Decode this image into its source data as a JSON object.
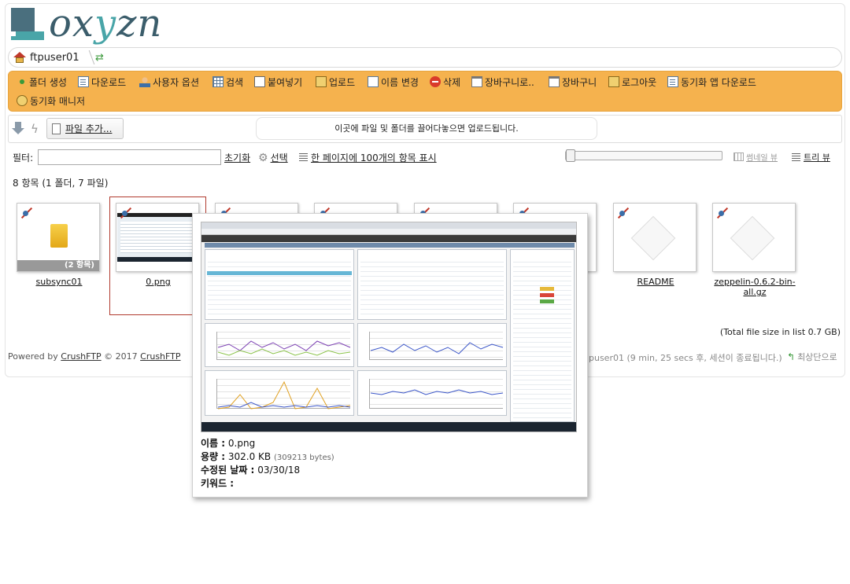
{
  "brand": {
    "logo_text_a": "ox",
    "logo_text_b": "y",
    "logo_text_c": "zn"
  },
  "breadcrumb": {
    "user": "ftpuser01"
  },
  "toolbar": {
    "items": [
      {
        "label": "폴더 생성"
      },
      {
        "label": "다운로드"
      },
      {
        "label": "사용자 옵션"
      },
      {
        "label": "검색"
      },
      {
        "label": "붙여넣기"
      },
      {
        "label": "업로드"
      },
      {
        "label": "이름 변경"
      },
      {
        "label": "삭제"
      },
      {
        "label": "장바구니로.."
      },
      {
        "label": "장바구니"
      },
      {
        "label": "로그아웃"
      },
      {
        "label": "동기화 앱 다운로드"
      },
      {
        "label": "동기화 매니저"
      }
    ]
  },
  "upload": {
    "add_file_label": "파일 추가...",
    "drop_text": "이곳에 파일 및 폴더를 끌어다놓으면 업로드됩니다."
  },
  "filter": {
    "label": "필터:",
    "value": "",
    "reset_label": "초기화",
    "select_label": "선택",
    "per_page_label": "한 페이지에 100개의 항목 표시",
    "thumbnail_view_label": "썸네일 뷰",
    "tree_view_label": "트리 뷰"
  },
  "listing": {
    "count_text": "8 항목 (1 폴더, 7 파일)",
    "items": [
      {
        "name": "subsync01",
        "caption": "(2 항목)"
      },
      {
        "name": "0.png"
      },
      {
        "name": "README"
      },
      {
        "name": "zeppelin-0.6.2-bin-all.gz"
      }
    ],
    "total_size_text": "(Total file size in list 0.7 GB)"
  },
  "footer": {
    "powered_by": "Powered by",
    "crushftp": "CrushFTP",
    "copyright": "© 2017",
    "crushftp2": "CrushFTP",
    "session_text": "puser01 (9 min, 25 secs 후, 세션이 종료됩니다.)",
    "top_link": "최상단으로"
  },
  "preview": {
    "name_label": "이름 :",
    "name_value": "0.png",
    "size_label": "용량 :",
    "size_value": "302.0 KB",
    "size_bytes": "(309213 bytes)",
    "modified_label": "수정된 날짜 :",
    "modified_value": "03/30/18",
    "keyword_label": "키워드 :"
  },
  "colors": {
    "toolbar_bg": "#f5b24e",
    "brand_dark": "#3b5d6b",
    "brand_teal": "#49a5a8",
    "selection": "#b03a2e"
  }
}
